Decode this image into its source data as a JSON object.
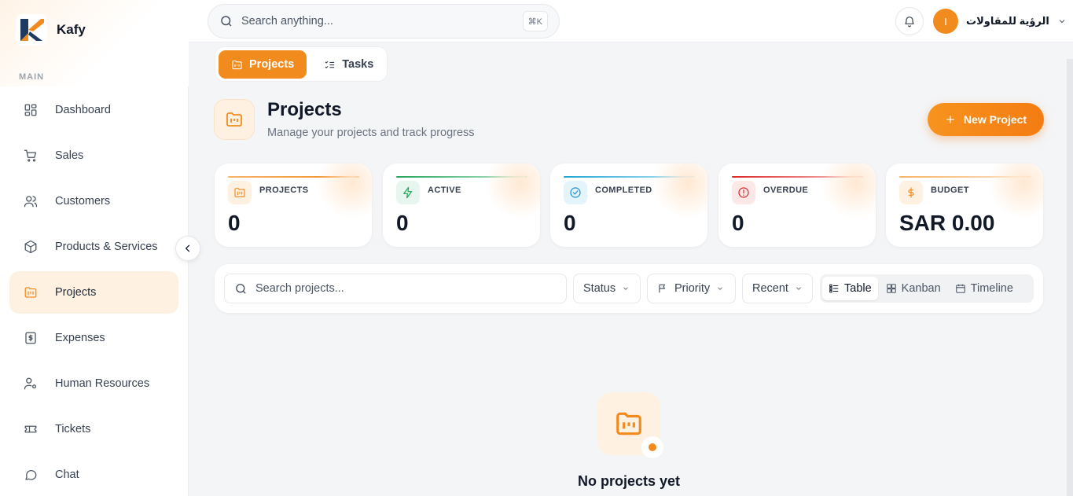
{
  "brand": {
    "name": "Kafy"
  },
  "sidebar": {
    "section": "MAIN",
    "items": [
      {
        "label": "Dashboard",
        "icon": "dashboard-icon"
      },
      {
        "label": "Sales",
        "icon": "cart-icon"
      },
      {
        "label": "Customers",
        "icon": "users-icon"
      },
      {
        "label": "Products & Services",
        "icon": "package-icon"
      },
      {
        "label": "Projects",
        "icon": "folder-kanban-icon",
        "active": true
      },
      {
        "label": "Expenses",
        "icon": "dollar-receipt-icon"
      },
      {
        "label": "Human Resources",
        "icon": "user-cog-icon"
      },
      {
        "label": "Tickets",
        "icon": "ticket-icon"
      },
      {
        "label": "Chat",
        "icon": "chat-icon"
      }
    ]
  },
  "topbar": {
    "search_placeholder": "Search anything...",
    "shortcut": "⌘K",
    "user_initial": "I",
    "user_name": "الرؤية للمقاولات"
  },
  "tabs": [
    {
      "label": "Projects",
      "active": true
    },
    {
      "label": "Tasks",
      "active": false
    }
  ],
  "header": {
    "title": "Projects",
    "subtitle": "Manage your projects and track progress",
    "new_button": "New Project"
  },
  "stats": [
    {
      "label": "PROJECTS",
      "value": "0",
      "color": "#f28b1e"
    },
    {
      "label": "ACTIVE",
      "value": "0",
      "color": "#22a35a"
    },
    {
      "label": "COMPLETED",
      "value": "0",
      "color": "#1ea5d4"
    },
    {
      "label": "OVERDUE",
      "value": "0",
      "color": "#dc2626"
    },
    {
      "label": "BUDGET",
      "value": "SAR 0.00",
      "color": "#f28b1e"
    }
  ],
  "filters": {
    "search_placeholder": "Search projects...",
    "status": "Status",
    "priority": "Priority",
    "sort": "Recent",
    "views": [
      {
        "label": "Table",
        "active": true
      },
      {
        "label": "Kanban",
        "active": false
      },
      {
        "label": "Timeline",
        "active": false
      }
    ]
  },
  "empty": {
    "title": "No projects yet"
  },
  "colors": {
    "accent": "#f28b1e"
  }
}
